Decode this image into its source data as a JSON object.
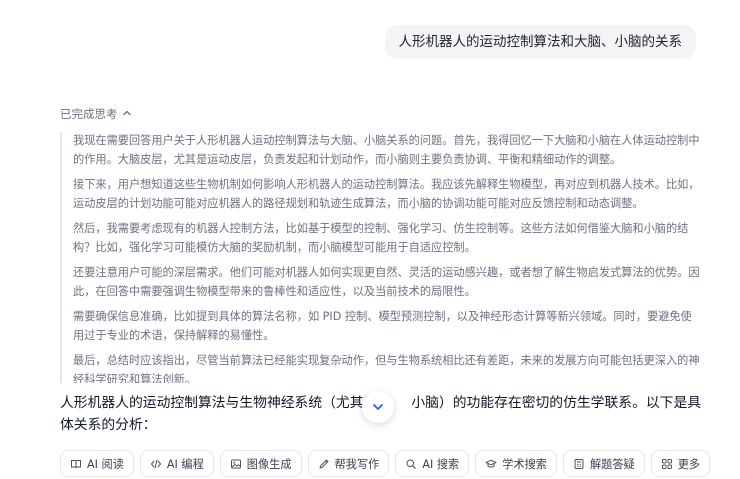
{
  "user_message": "人形机器人的运动控制算法和大脑、小脑的关系",
  "thinking": {
    "toggle_label": "已完成思考",
    "paragraphs": [
      "我现在需要回答用户关于人形机器人运动控制算法与大脑、小脑关系的问题。首先，我得回忆一下大脑和小脑在人体运动控制中的作用。大脑皮层，尤其是运动皮层，负责发起和计划动作，而小脑则主要负责协调、平衡和精细动作的调整。",
      "接下来，用户想知道这些生物机制如何影响人形机器人的运动控制算法。我应该先解释生物模型，再对应到机器人技术。比如，运动皮层的计划功能可能对应机器人的路径规划和轨迹生成算法，而小脑的协调功能可能对应反馈控制和动态调整。",
      "然后，我需要考虑现有的机器人控制方法，比如基于模型的控制、强化学习、仿生控制等。这些方法如何借鉴大脑和小脑的结构？比如，强化学习可能模仿大脑的奖励机制，而小脑模型可能用于自适应控制。",
      "还要注意用户可能的深层需求。他们可能对机器人如何实现更自然、灵活的运动感兴趣，或者想了解生物启发式算法的优势。因此，在回答中需要强调生物模型带来的鲁棒性和适应性，以及当前技术的局限性。",
      "需要确保信息准确，比如提到具体的算法名称，如 PID 控制、模型预测控制，以及神经形态计算等新兴领域。同时，要避免使用过于专业的术语，保持解释的易懂性。",
      "最后，总结时应该指出，尽管当前算法已经能实现复杂动作，但与生物系统相比还有差距，未来的发展方向可能包括更深入的神经科学研究和算法创新。"
    ]
  },
  "answer": {
    "text_before": "人形机器人的运动控制算法与生物神经系统（尤其是",
    "text_after": "小脑）的功能存在密切的仿生学联系。以下是具体关系的分析："
  },
  "toolbar": {
    "buttons": [
      {
        "label": "AI 阅读",
        "icon": "book-icon"
      },
      {
        "label": "AI 编程",
        "icon": "code-icon"
      },
      {
        "label": "图像生成",
        "icon": "image-icon"
      },
      {
        "label": "帮我写作",
        "icon": "pen-icon"
      },
      {
        "label": "AI 搜索",
        "icon": "search-icon"
      },
      {
        "label": "学术搜索",
        "icon": "graduation-cap-icon"
      },
      {
        "label": "解题答疑",
        "icon": "calculator-icon"
      },
      {
        "label": "更多",
        "icon": "grid-icon"
      }
    ]
  }
}
